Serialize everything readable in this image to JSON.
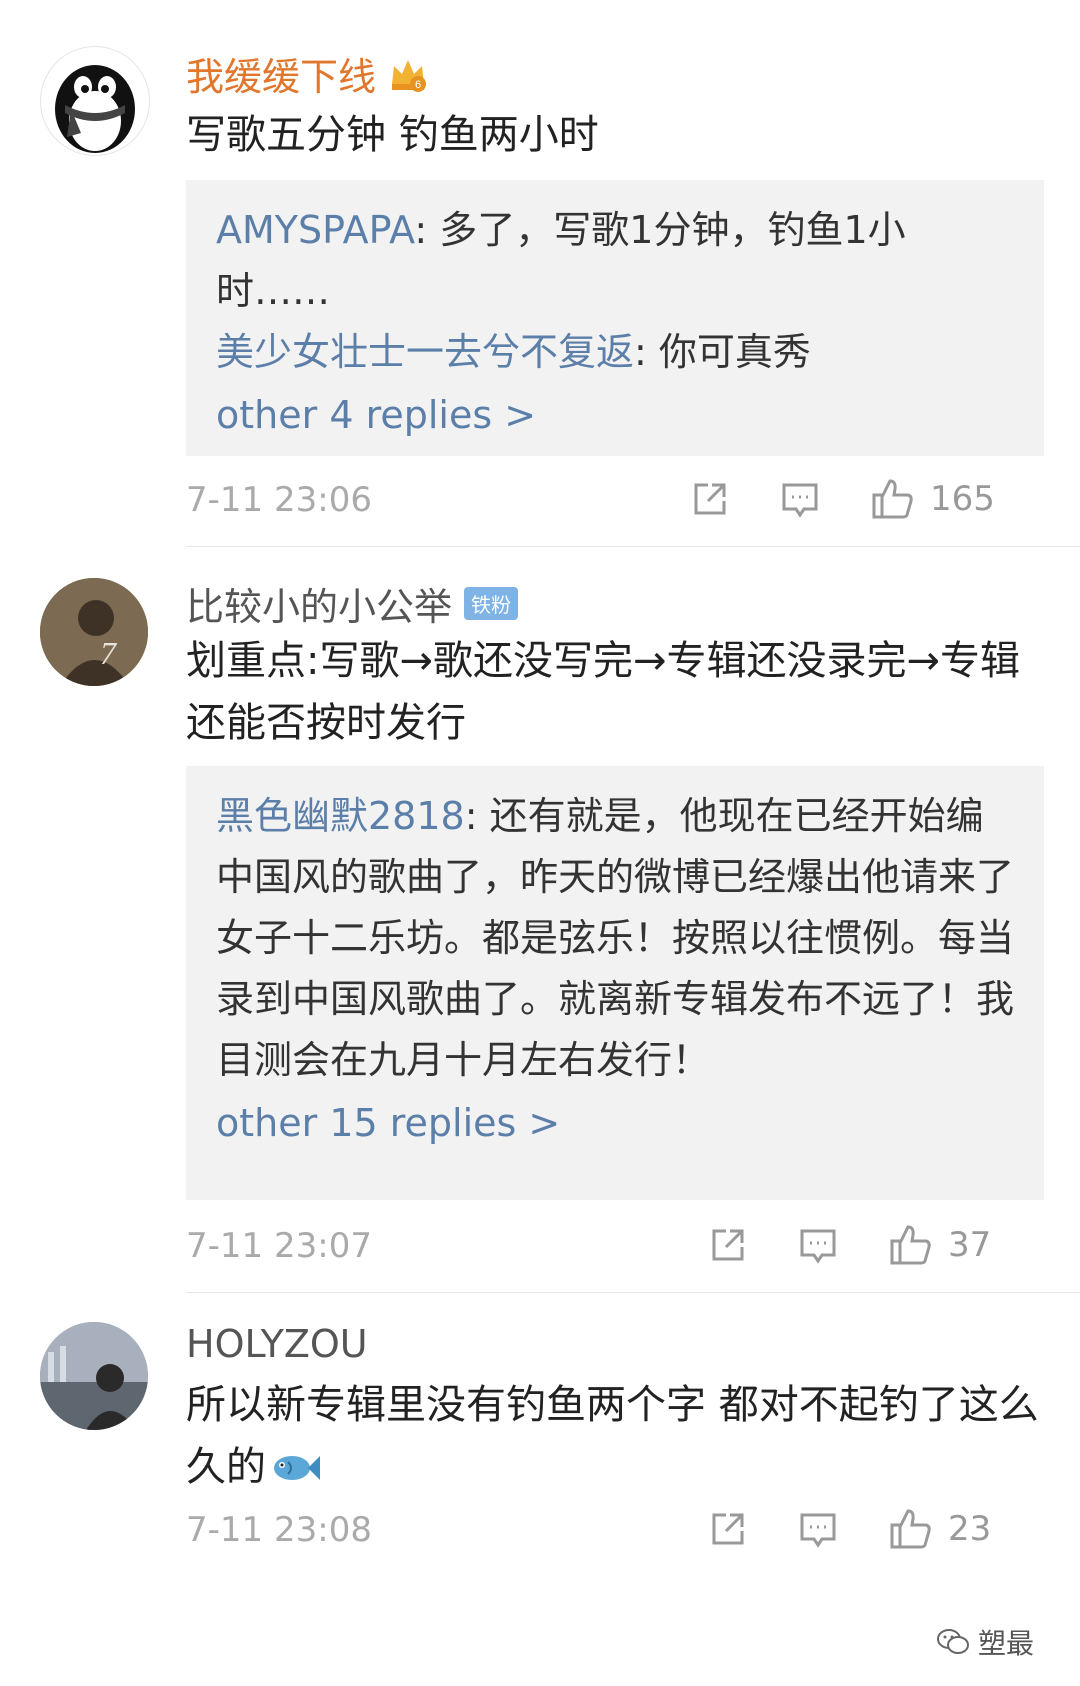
{
  "colors": {
    "vip_name": "#e0772d",
    "link_blue": "#5b7fa8",
    "reply_bg": "#f2f2f2",
    "meta_gray": "#aaaaaa",
    "fan_badge": "#7fb2e5"
  },
  "comments": [
    {
      "username": "我缓缓下线",
      "badge": "crown-badge-icon",
      "text": "写歌五分钟 钓鱼两小时",
      "replies": [
        {
          "user": "AMYSPAPA",
          "text": ": 多了，写歌1分钟，钓鱼1小时……"
        },
        {
          "user": "美少女壮士一去兮不复返",
          "text": ": 你可真秀"
        }
      ],
      "more_replies": "other 4 replies >",
      "time": "7-11 23:06",
      "likes": "165"
    },
    {
      "username": "比较小的小公举",
      "badge_text": "铁粉",
      "text": "划重点:写歌→歌还没写完→专辑还没录完→专辑还能否按时发行",
      "replies": [
        {
          "user": "黑色幽默2818",
          "text": ": 还有就是，他现在已经开始编中国风的歌曲了，昨天的微博已经爆出他请来了女子十二乐坊。都是弦乐！按照以往惯例。每当录到中国风歌曲了。就离新专辑发布不远了！我目测会在九月十月左右发行！"
        }
      ],
      "more_replies": "other 15 replies >",
      "time": "7-11 23:07",
      "likes": "37"
    },
    {
      "username": "HOLYZOU",
      "text": "所以新专辑里没有钓鱼两个字 都对不起钓了这么久的",
      "emoji": "fish-emoji-icon",
      "time": "7-11 23:08",
      "likes": "23"
    }
  ],
  "watermark": {
    "text": "塑最"
  }
}
